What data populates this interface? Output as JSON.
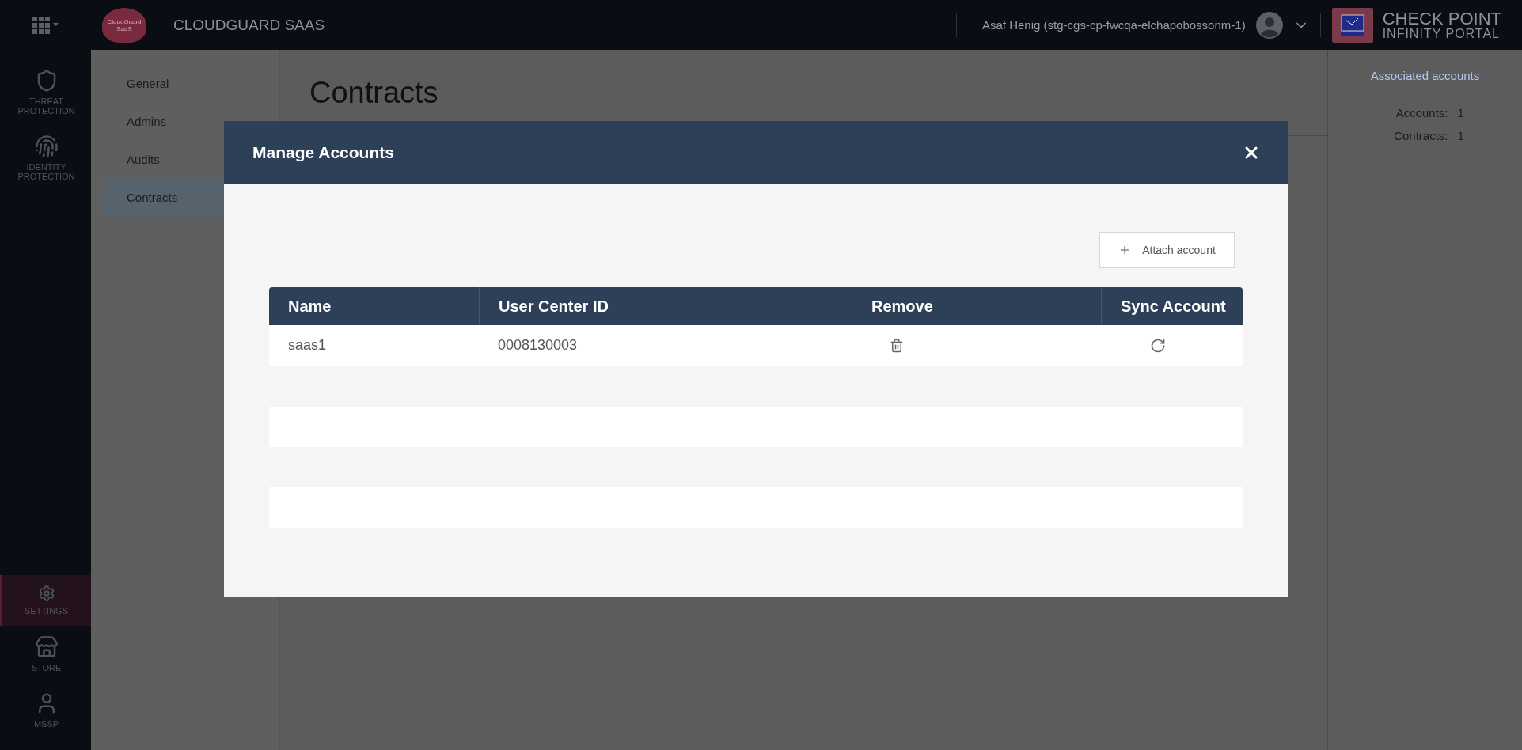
{
  "topbar": {
    "logo_text": [
      "CloudGuard",
      "SaaS"
    ],
    "app_title": "CLOUDGUARD SAAS",
    "user": "Asaf Henig (stg-cgs-cp-fwcqa-elchapobossonm-1)",
    "brand": [
      "CHECK POINT",
      "INFINITY PORTAL"
    ]
  },
  "rail": [
    {
      "label": "THREAT PROTECTION",
      "kind": "shield",
      "selected": false
    },
    {
      "label": "IDENTITY PROTECTION",
      "kind": "fingerprint",
      "selected": false
    },
    {
      "label": "SETTINGS",
      "kind": "gear",
      "selected": true
    },
    {
      "label": "STORE",
      "kind": "store",
      "selected": false
    },
    {
      "label": "MSSP",
      "kind": "person",
      "selected": false
    }
  ],
  "settings_nav": [
    {
      "label": "General",
      "selected": false
    },
    {
      "label": "Admins",
      "selected": false
    },
    {
      "label": "Audits",
      "selected": false
    },
    {
      "label": "Contracts",
      "selected": true
    }
  ],
  "page": {
    "title": "Contracts"
  },
  "summary": {
    "link": "Associated accounts",
    "stats": [
      {
        "label": "Accounts:",
        "value": "1"
      },
      {
        "label": "Contracts:",
        "value": "1"
      }
    ]
  },
  "modal": {
    "title": "Manage Accounts",
    "attach_button": "Attach account",
    "columns": [
      "Name",
      "User Center ID",
      "Remove",
      "Sync Account"
    ],
    "rows": [
      {
        "name": "saas1",
        "user_center_id": "0008130003"
      }
    ]
  }
}
